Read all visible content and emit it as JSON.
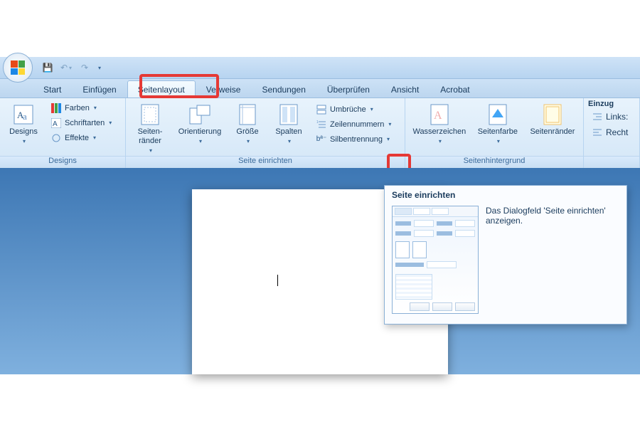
{
  "qat": {
    "save": "💾",
    "undo": "↶",
    "redo": "↷"
  },
  "tabs": {
    "start": "Start",
    "einfuegen": "Einfügen",
    "seitenlayout": "Seitenlayout",
    "verweise": "Verweise",
    "sendungen": "Sendungen",
    "ueberpruefen": "Überprüfen",
    "ansicht": "Ansicht",
    "acrobat": "Acrobat"
  },
  "groups": {
    "designs": {
      "label": "Designs",
      "designs": "Designs",
      "farben": "Farben",
      "schriftarten": "Schriftarten",
      "effekte": "Effekte"
    },
    "seite": {
      "label": "Seite einrichten",
      "seitenraender": "Seiten-\nränder",
      "orientierung": "Orientierung",
      "groesse": "Größe",
      "spalten": "Spalten",
      "umbrueche": "Umbrüche",
      "zeilennummern": "Zeilennummern",
      "silbentrennung": "Silbentrennung"
    },
    "hintergrund": {
      "label": "Seitenhintergrund",
      "wasserzeichen": "Wasserzeichen",
      "seitenfarbe": "Seitenfarbe",
      "seitenraender2": "Seitenränder"
    },
    "absatz": {
      "label_einzug": "Einzug",
      "links": "Links:",
      "rechts": "Recht"
    }
  },
  "tooltip": {
    "title": "Seite einrichten",
    "text": "Das Dialogfeld 'Seite einrichten' anzeigen."
  }
}
